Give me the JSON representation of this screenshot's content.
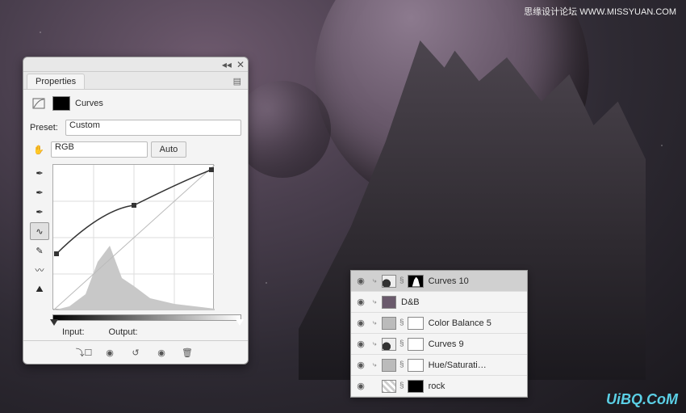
{
  "watermark_top": "思缘设计论坛  WWW.MISSYUAN.COM",
  "watermark_bottom": "UiBQ.CoM",
  "properties": {
    "tab": "Properties",
    "section": "Curves",
    "preset_label": "Preset:",
    "preset_value": "Custom",
    "channel_value": "RGB",
    "auto_label": "Auto",
    "input_label": "Input:",
    "output_label": "Output:"
  },
  "curve": {
    "points": [
      {
        "x": 0,
        "y": 114
      },
      {
        "x": 96,
        "y": 54
      },
      {
        "x": 192,
        "y": 0
      }
    ],
    "input_range": [
      0,
      255
    ],
    "output_range": [
      0,
      255
    ]
  },
  "chart_data": {
    "type": "line",
    "title": "Curves",
    "xlabel": "Input",
    "ylabel": "Output",
    "xlim": [
      0,
      255
    ],
    "ylim": [
      0,
      255
    ],
    "series": [
      {
        "name": "RGB curve",
        "x": [
          0,
          128,
          255
        ],
        "y": [
          104,
          184,
          255
        ]
      }
    ]
  },
  "layers": [
    {
      "name": "Curves 10",
      "type": "curves",
      "mask": "shape",
      "clipped": true,
      "selected": true
    },
    {
      "name": "D&B",
      "type": "db",
      "mask": "none",
      "clipped": true,
      "selected": false
    },
    {
      "name": "Color Balance 5",
      "type": "adjust",
      "mask": "white",
      "clipped": true,
      "selected": false
    },
    {
      "name": "Curves 9",
      "type": "curves",
      "mask": "white",
      "clipped": true,
      "selected": false
    },
    {
      "name": "Hue/Saturati…",
      "type": "adjust",
      "mask": "white",
      "clipped": true,
      "selected": false
    },
    {
      "name": "rock",
      "type": "group",
      "mask": "black",
      "clipped": false,
      "selected": false
    }
  ]
}
